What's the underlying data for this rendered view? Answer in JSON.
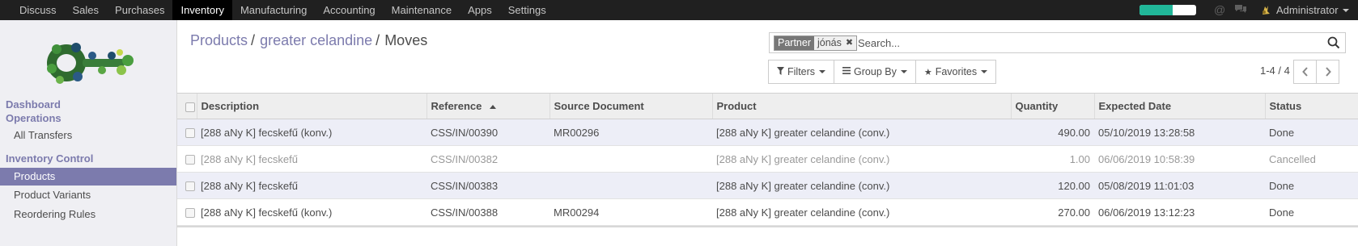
{
  "topbar": {
    "menu": [
      "Discuss",
      "Sales",
      "Purchases",
      "Inventory",
      "Manufacturing",
      "Accounting",
      "Maintenance",
      "Apps",
      "Settings"
    ],
    "active_menu": "Inventory",
    "progress_fraction": 0.58,
    "progress_color": "#21b799",
    "user_name": "Administrator"
  },
  "sidebar": {
    "section1_title": "Dashboard\nOperations",
    "section1_items": [
      "All Transfers"
    ],
    "section2_title": "Inventory Control",
    "section2_items": [
      "Products",
      "Product Variants",
      "Reordering Rules"
    ],
    "active_item": "Products"
  },
  "breadcrumb": {
    "items": [
      "Products",
      "greater celandine",
      "Moves"
    ]
  },
  "search": {
    "facet_category": "Partner",
    "facet_value": "jónás",
    "placeholder": "Search..."
  },
  "filters": {
    "filters_label": "Filters",
    "groupby_label": "Group By",
    "favorites_label": "Favorites"
  },
  "pager": {
    "value": "1-4 / 4"
  },
  "table": {
    "columns": [
      "Description",
      "Reference",
      "Source Document",
      "Product",
      "Quantity",
      "Expected Date",
      "Status"
    ],
    "sorted_column": "Reference",
    "rows": [
      {
        "description": "[288 aNy K] fecskefű (konv.)",
        "reference": "CSS/IN/00390",
        "source": "MR00296",
        "product": "[288 aNy K] greater celandine (conv.)",
        "quantity": "490.00",
        "date": "05/10/2019 13:28:58",
        "status": "Done"
      },
      {
        "description": "[288 aNy K] fecskefű",
        "reference": "CSS/IN/00382",
        "source": "",
        "product": "[288 aNy K] greater celandine (conv.)",
        "quantity": "1.00",
        "date": "06/06/2019 10:58:39",
        "status": "Cancelled"
      },
      {
        "description": "[288 aNy K] fecskefű",
        "reference": "CSS/IN/00383",
        "source": "",
        "product": "[288 aNy K] greater celandine (conv.)",
        "quantity": "120.00",
        "date": "05/08/2019 11:01:03",
        "status": "Done"
      },
      {
        "description": "[288 aNy K] fecskefű (konv.)",
        "reference": "CSS/IN/00388",
        "source": "MR00294",
        "product": "[288 aNy K] greater celandine (conv.)",
        "quantity": "270.00",
        "date": "06/06/2019 13:12:23",
        "status": "Done"
      }
    ]
  },
  "colors": {
    "accent": "#7c7bad",
    "navbar": "#202020",
    "row_highlight": "#edeef7"
  }
}
